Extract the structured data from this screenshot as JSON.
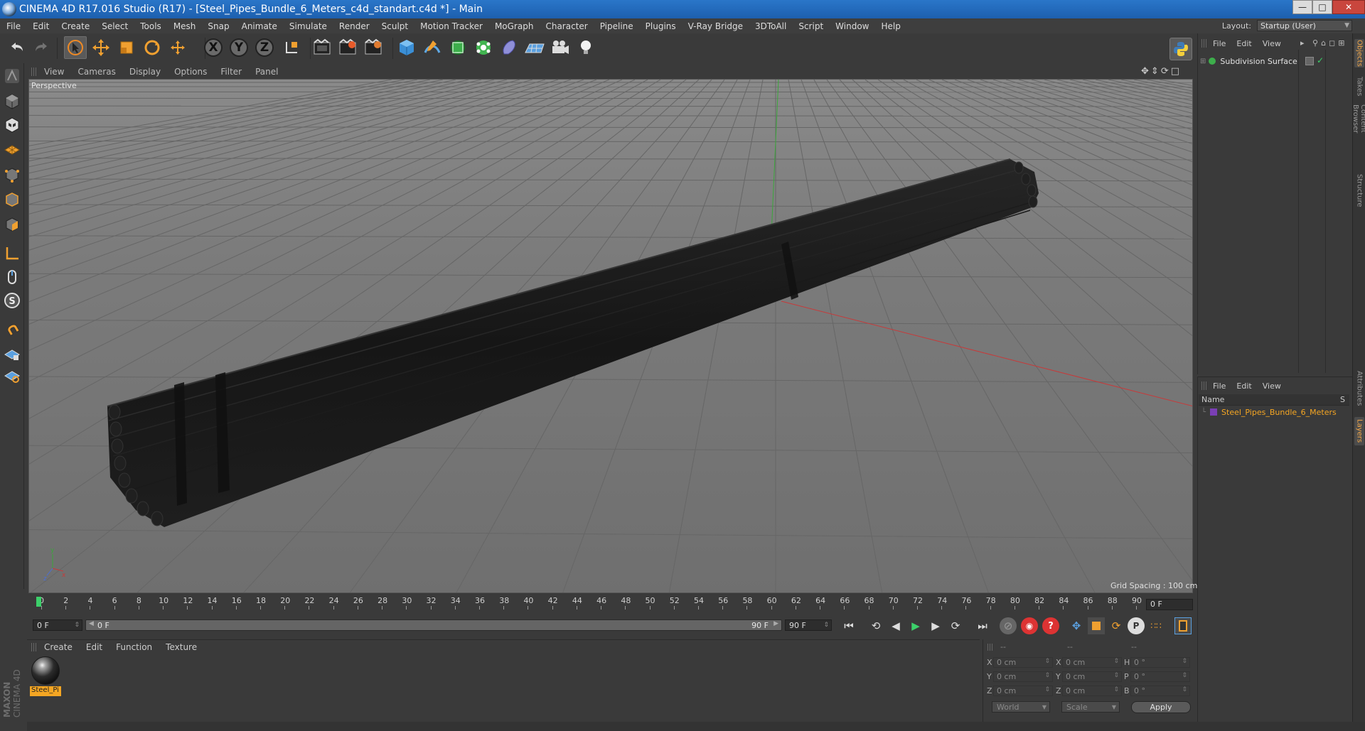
{
  "window": {
    "title": "CINEMA 4D R17.016 Studio (R17) - [Steel_Pipes_Bundle_6_Meters_c4d_standart.c4d *] - Main"
  },
  "menu": {
    "items": [
      "File",
      "Edit",
      "Create",
      "Select",
      "Tools",
      "Mesh",
      "Snap",
      "Animate",
      "Simulate",
      "Render",
      "Sculpt",
      "Motion Tracker",
      "MoGraph",
      "Character",
      "Pipeline",
      "Plugins",
      "V-Ray Bridge",
      "3DToAll",
      "Script",
      "Window",
      "Help"
    ],
    "layout_label": "Layout:",
    "layout_value": "Startup (User)"
  },
  "toolbar": {
    "axis_x": "X",
    "axis_y": "Y",
    "axis_z": "Z"
  },
  "viewport": {
    "menu": [
      "View",
      "Cameras",
      "Display",
      "Options",
      "Filter",
      "Panel"
    ],
    "camera_label": "Perspective",
    "grid_spacing": "Grid Spacing : 100 cm"
  },
  "timeline": {
    "ticks": [
      0,
      2,
      4,
      6,
      8,
      10,
      12,
      14,
      16,
      18,
      20,
      22,
      24,
      26,
      28,
      30,
      32,
      34,
      36,
      38,
      40,
      42,
      44,
      46,
      48,
      50,
      52,
      54,
      56,
      58,
      60,
      62,
      64,
      66,
      68,
      70,
      72,
      74,
      76,
      78,
      80,
      82,
      84,
      86,
      88,
      90
    ],
    "current_frame_right": "0 F",
    "start_field": "0 F",
    "range_start": "0 F",
    "range_end": "90 F",
    "end_field": "90 F"
  },
  "material_manager": {
    "menu": [
      "Create",
      "Edit",
      "Function",
      "Texture"
    ],
    "material_name": "Steel_Pi",
    "brand_line1": "MAXON",
    "brand_line2": "CINEMA 4D"
  },
  "coordinates": {
    "header": [
      "--",
      "--",
      "--"
    ],
    "rows": [
      {
        "label": "X",
        "pos": "0 cm",
        "label2": "X",
        "size": "0 cm",
        "label3": "H",
        "rot": "0 °"
      },
      {
        "label": "Y",
        "pos": "0 cm",
        "label2": "Y",
        "size": "0 cm",
        "label3": "P",
        "rot": "0 °"
      },
      {
        "label": "Z",
        "pos": "0 cm",
        "label2": "Z",
        "size": "0 cm",
        "label3": "B",
        "rot": "0 °"
      }
    ],
    "space_dropdown": "World",
    "mode_dropdown": "Scale",
    "apply_label": "Apply"
  },
  "object_manager": {
    "menu": [
      "File",
      "Edit",
      "View"
    ],
    "objects": [
      {
        "name": "Subdivision Surface"
      }
    ]
  },
  "layer_manager": {
    "menu": [
      "File",
      "Edit",
      "View"
    ],
    "col_name": "Name",
    "col_s": "S",
    "layers": [
      {
        "name": "Steel_Pipes_Bundle_6_Meters",
        "color": "#7a3fb5"
      }
    ]
  },
  "side_tabs": [
    "Objects",
    "Takes",
    "Content Browser",
    "Structure",
    "Attributes",
    "Layers"
  ],
  "colors": {
    "accent": "#f5a623",
    "title_bar": "#1d5fae",
    "play_green": "#3cd06a",
    "x_axis": "#c73a3a",
    "y_axis": "#3ab03a"
  }
}
